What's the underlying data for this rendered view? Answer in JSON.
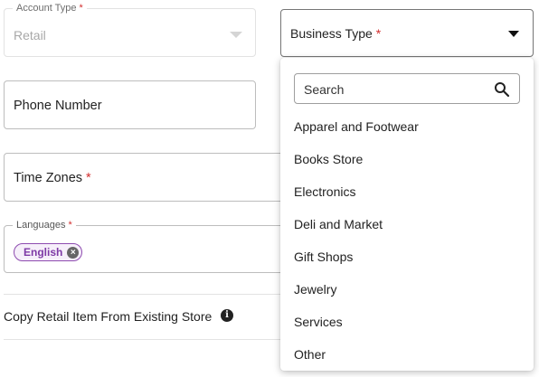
{
  "form": {
    "account_type": {
      "label": "Account Type",
      "required_mark": "*",
      "value": "Retail"
    },
    "business_type": {
      "label": "Business Type",
      "required_mark": "*"
    },
    "phone_number": {
      "label": "Phone Number"
    },
    "time_zones": {
      "label": "Time Zones",
      "required_mark": "*"
    },
    "languages": {
      "label": "Languages",
      "required_mark": "*",
      "chips": [
        "English"
      ]
    },
    "copy_retail": {
      "label": "Copy Retail Item From Existing Store"
    }
  },
  "dropdown": {
    "search_placeholder": "Search",
    "options": [
      "Apparel and Footwear",
      "Books Store",
      "Electronics",
      "Deli and Market",
      "Gift Shops",
      "Jewelry",
      "Services",
      "Other"
    ]
  },
  "colors": {
    "required": "#d32f2f",
    "chip_accent": "#8e4cb0",
    "border": "#bdbdbd"
  },
  "icons": {
    "account_caret": "chevron-down-icon",
    "business_caret": "caret-down-icon",
    "chip_remove": "close-circle-icon",
    "info": "info-icon",
    "search": "search-icon"
  }
}
